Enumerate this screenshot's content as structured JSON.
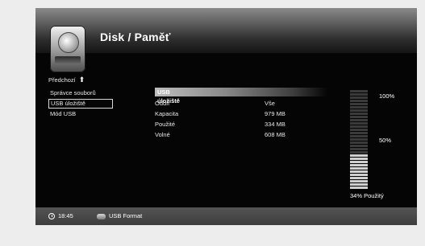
{
  "header": {
    "title": "Disk / Paměť",
    "icon": "disk-icon"
  },
  "nav": {
    "back_label": "Předchozí",
    "items": [
      {
        "label": "Správce souborů",
        "active": false
      },
      {
        "label": "USB úložiště",
        "active": true
      },
      {
        "label": "Mód USB",
        "active": false
      }
    ]
  },
  "content": {
    "section_title": "USB úložiště",
    "rows": [
      {
        "label": "Oddíl",
        "value": "Vše"
      },
      {
        "label": "Kapacita",
        "value": "979 MB"
      },
      {
        "label": "Použité",
        "value": "334 MB"
      },
      {
        "label": "Volné",
        "value": "608 MB"
      }
    ]
  },
  "usage_meter": {
    "top_label": "100%",
    "mid_label": "50%",
    "used_label": "34% Použitý",
    "used_fraction": 0.34,
    "segments": 31,
    "colors": {
      "used": "#cfcfcf",
      "free": "#3a3a3a"
    }
  },
  "footer": {
    "time": "18:45",
    "format_label": "USB Format"
  }
}
